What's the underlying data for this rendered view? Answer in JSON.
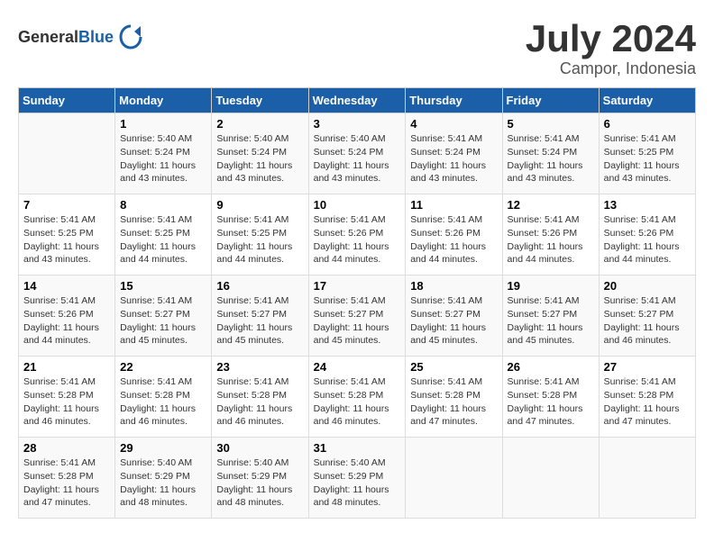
{
  "header": {
    "logo_general": "General",
    "logo_blue": "Blue",
    "month_title": "July 2024",
    "location": "Campor, Indonesia"
  },
  "days_of_week": [
    "Sunday",
    "Monday",
    "Tuesday",
    "Wednesday",
    "Thursday",
    "Friday",
    "Saturday"
  ],
  "weeks": [
    [
      {
        "day": "",
        "sunrise": "",
        "sunset": "",
        "daylight": ""
      },
      {
        "day": "1",
        "sunrise": "Sunrise: 5:40 AM",
        "sunset": "Sunset: 5:24 PM",
        "daylight": "Daylight: 11 hours and 43 minutes."
      },
      {
        "day": "2",
        "sunrise": "Sunrise: 5:40 AM",
        "sunset": "Sunset: 5:24 PM",
        "daylight": "Daylight: 11 hours and 43 minutes."
      },
      {
        "day": "3",
        "sunrise": "Sunrise: 5:40 AM",
        "sunset": "Sunset: 5:24 PM",
        "daylight": "Daylight: 11 hours and 43 minutes."
      },
      {
        "day": "4",
        "sunrise": "Sunrise: 5:41 AM",
        "sunset": "Sunset: 5:24 PM",
        "daylight": "Daylight: 11 hours and 43 minutes."
      },
      {
        "day": "5",
        "sunrise": "Sunrise: 5:41 AM",
        "sunset": "Sunset: 5:24 PM",
        "daylight": "Daylight: 11 hours and 43 minutes."
      },
      {
        "day": "6",
        "sunrise": "Sunrise: 5:41 AM",
        "sunset": "Sunset: 5:25 PM",
        "daylight": "Daylight: 11 hours and 43 minutes."
      }
    ],
    [
      {
        "day": "7",
        "sunrise": "Sunrise: 5:41 AM",
        "sunset": "Sunset: 5:25 PM",
        "daylight": "Daylight: 11 hours and 43 minutes."
      },
      {
        "day": "8",
        "sunrise": "Sunrise: 5:41 AM",
        "sunset": "Sunset: 5:25 PM",
        "daylight": "Daylight: 11 hours and 44 minutes."
      },
      {
        "day": "9",
        "sunrise": "Sunrise: 5:41 AM",
        "sunset": "Sunset: 5:25 PM",
        "daylight": "Daylight: 11 hours and 44 minutes."
      },
      {
        "day": "10",
        "sunrise": "Sunrise: 5:41 AM",
        "sunset": "Sunset: 5:26 PM",
        "daylight": "Daylight: 11 hours and 44 minutes."
      },
      {
        "day": "11",
        "sunrise": "Sunrise: 5:41 AM",
        "sunset": "Sunset: 5:26 PM",
        "daylight": "Daylight: 11 hours and 44 minutes."
      },
      {
        "day": "12",
        "sunrise": "Sunrise: 5:41 AM",
        "sunset": "Sunset: 5:26 PM",
        "daylight": "Daylight: 11 hours and 44 minutes."
      },
      {
        "day": "13",
        "sunrise": "Sunrise: 5:41 AM",
        "sunset": "Sunset: 5:26 PM",
        "daylight": "Daylight: 11 hours and 44 minutes."
      }
    ],
    [
      {
        "day": "14",
        "sunrise": "Sunrise: 5:41 AM",
        "sunset": "Sunset: 5:26 PM",
        "daylight": "Daylight: 11 hours and 44 minutes."
      },
      {
        "day": "15",
        "sunrise": "Sunrise: 5:41 AM",
        "sunset": "Sunset: 5:27 PM",
        "daylight": "Daylight: 11 hours and 45 minutes."
      },
      {
        "day": "16",
        "sunrise": "Sunrise: 5:41 AM",
        "sunset": "Sunset: 5:27 PM",
        "daylight": "Daylight: 11 hours and 45 minutes."
      },
      {
        "day": "17",
        "sunrise": "Sunrise: 5:41 AM",
        "sunset": "Sunset: 5:27 PM",
        "daylight": "Daylight: 11 hours and 45 minutes."
      },
      {
        "day": "18",
        "sunrise": "Sunrise: 5:41 AM",
        "sunset": "Sunset: 5:27 PM",
        "daylight": "Daylight: 11 hours and 45 minutes."
      },
      {
        "day": "19",
        "sunrise": "Sunrise: 5:41 AM",
        "sunset": "Sunset: 5:27 PM",
        "daylight": "Daylight: 11 hours and 45 minutes."
      },
      {
        "day": "20",
        "sunrise": "Sunrise: 5:41 AM",
        "sunset": "Sunset: 5:27 PM",
        "daylight": "Daylight: 11 hours and 46 minutes."
      }
    ],
    [
      {
        "day": "21",
        "sunrise": "Sunrise: 5:41 AM",
        "sunset": "Sunset: 5:28 PM",
        "daylight": "Daylight: 11 hours and 46 minutes."
      },
      {
        "day": "22",
        "sunrise": "Sunrise: 5:41 AM",
        "sunset": "Sunset: 5:28 PM",
        "daylight": "Daylight: 11 hours and 46 minutes."
      },
      {
        "day": "23",
        "sunrise": "Sunrise: 5:41 AM",
        "sunset": "Sunset: 5:28 PM",
        "daylight": "Daylight: 11 hours and 46 minutes."
      },
      {
        "day": "24",
        "sunrise": "Sunrise: 5:41 AM",
        "sunset": "Sunset: 5:28 PM",
        "daylight": "Daylight: 11 hours and 46 minutes."
      },
      {
        "day": "25",
        "sunrise": "Sunrise: 5:41 AM",
        "sunset": "Sunset: 5:28 PM",
        "daylight": "Daylight: 11 hours and 47 minutes."
      },
      {
        "day": "26",
        "sunrise": "Sunrise: 5:41 AM",
        "sunset": "Sunset: 5:28 PM",
        "daylight": "Daylight: 11 hours and 47 minutes."
      },
      {
        "day": "27",
        "sunrise": "Sunrise: 5:41 AM",
        "sunset": "Sunset: 5:28 PM",
        "daylight": "Daylight: 11 hours and 47 minutes."
      }
    ],
    [
      {
        "day": "28",
        "sunrise": "Sunrise: 5:41 AM",
        "sunset": "Sunset: 5:28 PM",
        "daylight": "Daylight: 11 hours and 47 minutes."
      },
      {
        "day": "29",
        "sunrise": "Sunrise: 5:40 AM",
        "sunset": "Sunset: 5:29 PM",
        "daylight": "Daylight: 11 hours and 48 minutes."
      },
      {
        "day": "30",
        "sunrise": "Sunrise: 5:40 AM",
        "sunset": "Sunset: 5:29 PM",
        "daylight": "Daylight: 11 hours and 48 minutes."
      },
      {
        "day": "31",
        "sunrise": "Sunrise: 5:40 AM",
        "sunset": "Sunset: 5:29 PM",
        "daylight": "Daylight: 11 hours and 48 minutes."
      },
      {
        "day": "",
        "sunrise": "",
        "sunset": "",
        "daylight": ""
      },
      {
        "day": "",
        "sunrise": "",
        "sunset": "",
        "daylight": ""
      },
      {
        "day": "",
        "sunrise": "",
        "sunset": "",
        "daylight": ""
      }
    ]
  ]
}
